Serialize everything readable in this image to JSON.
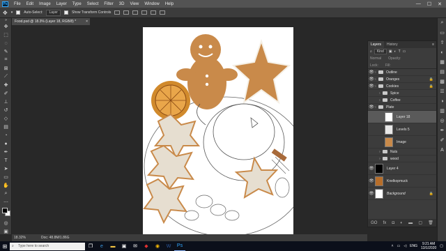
{
  "app": {
    "menu": [
      "File",
      "Edit",
      "Image",
      "Layer",
      "Type",
      "Select",
      "Filter",
      "3D",
      "View",
      "Window",
      "Help"
    ],
    "ps_logo": "Ps",
    "window_controls": [
      "—",
      "☐",
      "✕"
    ]
  },
  "options_bar": {
    "auto_select_label": "Auto-Select:",
    "auto_select_value": "Layer",
    "show_transform_label": "Show Transform Controls"
  },
  "document": {
    "tab_title": "Food.psd @ 18.3% (Layer 18, RGB/8) *",
    "close": "×"
  },
  "status": {
    "zoom": "18.32%",
    "doc_size": "Doc: 48.8M/1.86G"
  },
  "layers_panel": {
    "tabs": [
      "Layers",
      "History"
    ],
    "filter_kind": "Kind",
    "blend_mode": "Normal",
    "opacity_label": "Opacity:",
    "lock_label": "Lock:",
    "fill_label": "Fill:",
    "layers": [
      {
        "name": "Outline",
        "type": "folder",
        "indent": 0,
        "visible": true,
        "locked": false
      },
      {
        "name": "Oranges",
        "type": "folder",
        "indent": 0,
        "visible": true,
        "locked": true
      },
      {
        "name": "Cookies",
        "type": "folder",
        "indent": 0,
        "visible": true,
        "locked": true
      },
      {
        "name": "Spice",
        "type": "folder",
        "indent": 1,
        "visible": false,
        "locked": false
      },
      {
        "name": "Coffee",
        "type": "folder",
        "indent": 1,
        "visible": false,
        "locked": false
      },
      {
        "name": "Plate",
        "type": "folder",
        "indent": 0,
        "visible": true,
        "locked": false
      },
      {
        "name": "Layer 18",
        "type": "layer",
        "indent": 2,
        "visible": false,
        "locked": false,
        "selected": true,
        "thumb": "#ffffff"
      },
      {
        "name": "Levels 5",
        "type": "layer",
        "indent": 2,
        "visible": false,
        "locked": false,
        "thumb": "#e8e8e8"
      },
      {
        "name": "Image",
        "type": "layer",
        "indent": 2,
        "visible": false,
        "locked": false,
        "thumb": "#c98a4a"
      },
      {
        "name": "Nuts",
        "type": "folder",
        "indent": 1,
        "visible": false,
        "locked": false
      },
      {
        "name": "wood",
        "type": "folder",
        "indent": 1,
        "visible": false,
        "locked": false
      },
      {
        "name": "Layer 4",
        "type": "layer",
        "indent": 0,
        "visible": true,
        "locked": false,
        "thumb": "#000000"
      },
      {
        "name": "Knelkopmuck",
        "type": "layer",
        "indent": 0,
        "visible": true,
        "locked": false,
        "thumb": "#b86e2a"
      },
      {
        "name": "Background",
        "type": "layer",
        "indent": 0,
        "visible": true,
        "locked": true,
        "italic": true,
        "thumb": "#ffffff"
      }
    ],
    "footer_icons": [
      "GO",
      "fx",
      "◘",
      "◐",
      "▬",
      "▢",
      "🗑"
    ]
  },
  "taskbar": {
    "search_placeholder": "Type here to search",
    "time": "9:21 AM",
    "date": "13/1/2020",
    "lang": "ENG"
  },
  "colors": {
    "accent": "#31a8ff",
    "cookie": "#c98a4a",
    "icing": "#f5f0e6"
  }
}
